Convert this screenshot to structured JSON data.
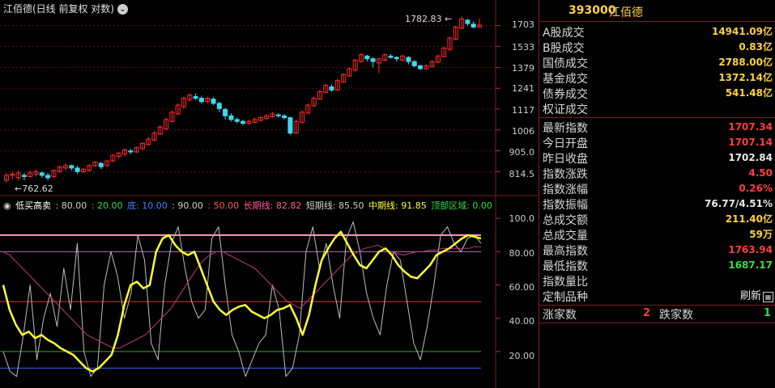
{
  "chart_header": {
    "title": "江佰德(日线 前复权 对数)",
    "menu_icon": "chevron-down-icon"
  },
  "price_axis": {
    "ticks": [
      "1703",
      "1533",
      "1379",
      "1241",
      "1117",
      "1006",
      "905.0",
      "814.5"
    ]
  },
  "price_annotations": {
    "high": "1782.83",
    "low": "762.62"
  },
  "indicator_axis": {
    "ticks": [
      "100.0",
      "80.00",
      "60.00",
      "40.00",
      "20.00"
    ]
  },
  "indicator_legend": [
    {
      "text": "低买高卖",
      "color": "#ffffff"
    },
    {
      "text": ": 80.00",
      "color": "#cfcfcf"
    },
    {
      "text": ": 20.00",
      "color": "#33dd44"
    },
    {
      "text": "底: 10.00",
      "color": "#4d7bff"
    },
    {
      "text": ": 90.00",
      "color": "#cfcfcf"
    },
    {
      "text": ": 50.00",
      "color": "#ff5a5a"
    },
    {
      "text": "长期线: 82.82",
      "color": "#ff5aa0"
    },
    {
      "text": "短期线: 85.50",
      "color": "#cfcfcf"
    },
    {
      "text": "中期线: 91.85",
      "color": "#ffff33"
    },
    {
      "text": "顶部区域: 0.00",
      "color": "#33dd44"
    }
  ],
  "candles": [
    [
      780,
      800,
      770,
      810
    ],
    [
      800,
      805,
      785,
      815
    ],
    [
      790,
      810,
      780,
      820
    ],
    [
      800,
      795,
      780,
      810
    ],
    [
      795,
      810,
      790,
      820
    ],
    [
      805,
      815,
      795,
      825
    ],
    [
      810,
      800,
      790,
      815
    ],
    [
      800,
      790,
      780,
      810
    ],
    [
      795,
      820,
      790,
      825
    ],
    [
      815,
      835,
      810,
      840
    ],
    [
      830,
      840,
      820,
      850
    ],
    [
      840,
      830,
      820,
      845
    ],
    [
      830,
      815,
      805,
      840
    ],
    [
      815,
      825,
      810,
      830
    ],
    [
      820,
      840,
      815,
      845
    ],
    [
      840,
      855,
      835,
      860
    ],
    [
      850,
      835,
      825,
      855
    ],
    [
      840,
      860,
      835,
      865
    ],
    [
      860,
      885,
      855,
      890
    ],
    [
      880,
      895,
      870,
      900
    ],
    [
      890,
      910,
      880,
      915
    ],
    [
      905,
      900,
      890,
      915
    ],
    [
      900,
      920,
      895,
      925
    ],
    [
      915,
      940,
      910,
      945
    ],
    [
      935,
      960,
      930,
      970
    ],
    [
      955,
      990,
      950,
      1000
    ],
    [
      985,
      1020,
      980,
      1030
    ],
    [
      1010,
      1060,
      1005,
      1070
    ],
    [
      1050,
      1100,
      1045,
      1110
    ],
    [
      1090,
      1140,
      1085,
      1150
    ],
    [
      1130,
      1180,
      1120,
      1190
    ],
    [
      1170,
      1200,
      1160,
      1210
    ],
    [
      1190,
      1180,
      1170,
      1210
    ],
    [
      1180,
      1160,
      1150,
      1195
    ],
    [
      1160,
      1180,
      1150,
      1190
    ],
    [
      1175,
      1150,
      1140,
      1185
    ],
    [
      1150,
      1120,
      1100,
      1160
    ],
    [
      1115,
      1080,
      1060,
      1125
    ],
    [
      1080,
      1060,
      1050,
      1095
    ],
    [
      1060,
      1050,
      1040,
      1070
    ],
    [
      1050,
      1040,
      1030,
      1060
    ],
    [
      1040,
      1050,
      1030,
      1060
    ],
    [
      1045,
      1060,
      1040,
      1070
    ],
    [
      1055,
      1070,
      1050,
      1080
    ],
    [
      1065,
      1080,
      1060,
      1090
    ],
    [
      1075,
      1090,
      1070,
      1100
    ],
    [
      1085,
      1080,
      1070,
      1095
    ],
    [
      1080,
      1070,
      1060,
      1090
    ],
    [
      1070,
      990,
      980,
      1075
    ],
    [
      990,
      1050,
      985,
      1060
    ],
    [
      1045,
      1100,
      1040,
      1110
    ],
    [
      1095,
      1140,
      1090,
      1150
    ],
    [
      1135,
      1180,
      1130,
      1190
    ],
    [
      1175,
      1220,
      1170,
      1230
    ],
    [
      1215,
      1260,
      1210,
      1270
    ],
    [
      1250,
      1230,
      1220,
      1265
    ],
    [
      1230,
      1290,
      1225,
      1300
    ],
    [
      1280,
      1330,
      1275,
      1340
    ],
    [
      1320,
      1370,
      1315,
      1380
    ],
    [
      1360,
      1430,
      1350,
      1440
    ],
    [
      1420,
      1470,
      1410,
      1480
    ],
    [
      1460,
      1440,
      1420,
      1470
    ],
    [
      1440,
      1420,
      1380,
      1450
    ],
    [
      1410,
      1440,
      1340,
      1445
    ],
    [
      1430,
      1470,
      1420,
      1480
    ],
    [
      1460,
      1450,
      1440,
      1475
    ],
    [
      1450,
      1440,
      1420,
      1460
    ],
    [
      1430,
      1460,
      1420,
      1470
    ],
    [
      1450,
      1420,
      1400,
      1460
    ],
    [
      1420,
      1390,
      1380,
      1430
    ],
    [
      1390,
      1370,
      1360,
      1400
    ],
    [
      1370,
      1390,
      1360,
      1400
    ],
    [
      1385,
      1420,
      1380,
      1430
    ],
    [
      1415,
      1460,
      1410,
      1470
    ],
    [
      1455,
      1520,
      1450,
      1530
    ],
    [
      1510,
      1600,
      1500,
      1610
    ],
    [
      1590,
      1690,
      1580,
      1700
    ],
    [
      1680,
      1760,
      1670,
      1783
    ],
    [
      1750,
      1720,
      1700,
      1760
    ],
    [
      1715,
      1690,
      1680,
      1740
    ],
    [
      1690,
      1707,
      1687,
      1764
    ]
  ],
  "indicator_series": {
    "mid": [
      60,
      45,
      36,
      30,
      32,
      28,
      30,
      27,
      25,
      22,
      20,
      18,
      14,
      10,
      8,
      10,
      14,
      18,
      30,
      48,
      60,
      62,
      58,
      60,
      80,
      88,
      90,
      84,
      80,
      78,
      80,
      70,
      60,
      50,
      45,
      42,
      45,
      47,
      48,
      44,
      42,
      40,
      42,
      45,
      46,
      48,
      40,
      30,
      42,
      60,
      75,
      82,
      88,
      92,
      85,
      78,
      72,
      70,
      75,
      80,
      82,
      78,
      72,
      68,
      65,
      64,
      68,
      72,
      78,
      80,
      82,
      85,
      88,
      90,
      89,
      88
    ],
    "long": [
      80,
      78,
      74,
      70,
      66,
      62,
      58,
      54,
      50,
      46,
      42,
      38,
      34,
      30,
      28,
      26,
      24,
      22,
      22,
      24,
      26,
      28,
      30,
      34,
      38,
      42,
      46,
      52,
      58,
      64,
      70,
      75,
      78,
      80,
      80,
      78,
      76,
      74,
      72,
      70,
      66,
      62,
      58,
      54,
      50,
      48,
      46,
      50,
      54,
      58,
      62,
      66,
      70,
      74,
      78,
      80,
      82,
      83,
      84,
      82,
      80,
      79,
      78,
      79,
      80,
      80,
      81,
      81,
      82,
      82,
      82,
      82,
      82,
      83,
      83
    ],
    "short": [
      20,
      8,
      5,
      30,
      60,
      15,
      40,
      55,
      35,
      70,
      45,
      85,
      20,
      5,
      10,
      60,
      80,
      65,
      40,
      55,
      90,
      75,
      25,
      15,
      60,
      85,
      95,
      70,
      50,
      40,
      45,
      88,
      95,
      60,
      30,
      20,
      5,
      15,
      25,
      30,
      60,
      45,
      5,
      10,
      30,
      80,
      95,
      70,
      85,
      60,
      40,
      88,
      98,
      80,
      55,
      40,
      30,
      60,
      80,
      75,
      50,
      25,
      15,
      35,
      60,
      90,
      95,
      85,
      80,
      88,
      90,
      85
    ]
  },
  "panel": {
    "code": "393000",
    "name": "江佰德",
    "rows_top": [
      {
        "label": "A股成交",
        "value": "14941.09亿",
        "color": "y"
      },
      {
        "label": "B股成交",
        "value": "0.83亿",
        "color": "y"
      },
      {
        "label": "国债成交",
        "value": "2788.00亿",
        "color": "y"
      },
      {
        "label": "基金成交",
        "value": "1372.14亿",
        "color": "y"
      },
      {
        "label": "债券成交",
        "value": "541.48亿",
        "color": "y"
      },
      {
        "label": "权证成交",
        "value": "",
        "color": "y"
      }
    ],
    "rows_mid": [
      {
        "label": "最新指数",
        "value": "1707.34",
        "color": "r"
      },
      {
        "label": "今日开盘",
        "value": "1707.14",
        "color": "r"
      },
      {
        "label": "昨日收盘",
        "value": "1702.84",
        "color": "w"
      },
      {
        "label": "指数涨跌",
        "value": "4.50",
        "color": "r"
      },
      {
        "label": "指数涨幅",
        "value": "0.26%",
        "color": "r"
      },
      {
        "label": "指数振幅",
        "value": "76.77/4.51%",
        "color": "w"
      },
      {
        "label": "总成交额",
        "value": "211.40亿",
        "color": "y"
      },
      {
        "label": "总成交量",
        "value": "59万",
        "color": "y"
      },
      {
        "label": "最高指数",
        "value": "1763.94",
        "color": "r"
      },
      {
        "label": "最低指数",
        "value": "1687.17",
        "color": "g"
      },
      {
        "label": "指数量比",
        "value": "",
        "color": "w"
      },
      {
        "label": "定制品种",
        "value": "刷新",
        "color": "w"
      }
    ],
    "rise_label": "涨家数",
    "rise_value": "2",
    "fall_label": "跌家数",
    "fall_value": "1",
    "refresh_icon": "grid-icon"
  }
}
